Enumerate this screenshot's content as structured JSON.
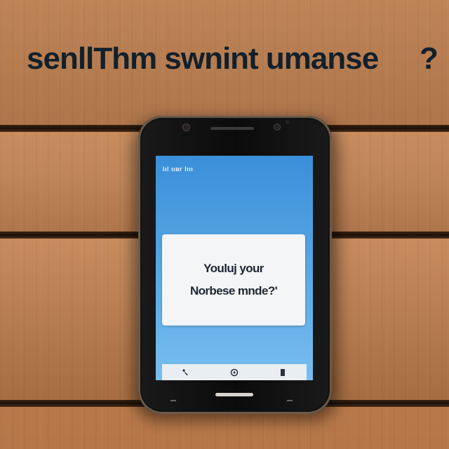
{
  "headline": {
    "text": "senllThm swnint umanse",
    "question_mark": "?"
  },
  "phone": {
    "status_text": "Iıl ııвг Iııı",
    "dialog": {
      "line1": "Youluj your",
      "line2": "Norbese mnde?'"
    },
    "nav_icons": [
      "back-icon",
      "home-icon",
      "recent-apps-icon"
    ]
  },
  "colors": {
    "wood": "#c58658",
    "screen": "#4a9de0",
    "headline": "#13202b"
  }
}
